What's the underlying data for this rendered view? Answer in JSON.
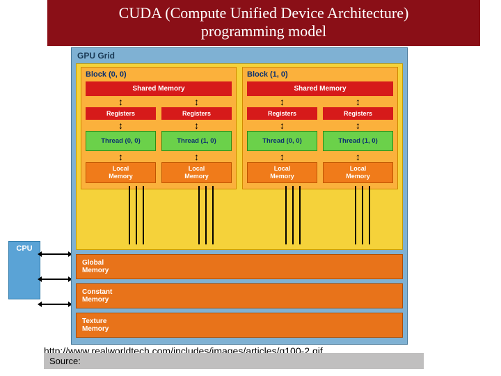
{
  "title": {
    "line1": "CUDA (Compute Unified Device Architecture)",
    "line2": "programming model"
  },
  "cpu_label": "CPU",
  "gpu": {
    "title": "GPU Grid",
    "blocks": [
      {
        "title": "Block (0, 0)",
        "shared": "Shared Memory",
        "regs": [
          "Registers",
          "Registers"
        ],
        "threads": [
          "Thread (0, 0)",
          "Thread (1, 0)"
        ],
        "locals": [
          "Local\nMemory",
          "Local\nMemory"
        ]
      },
      {
        "title": "Block (1, 0)",
        "shared": "Shared Memory",
        "regs": [
          "Registers",
          "Registers"
        ],
        "threads": [
          "Thread (0, 0)",
          "Thread (1, 0)"
        ],
        "locals": [
          "Local\nMemory",
          "Local\nMemory"
        ]
      }
    ],
    "global_mem": "Global\nMemory",
    "constant_mem": "Constant\nMemory",
    "texture_mem": "Texture\nMemory"
  },
  "source": {
    "label": "Source:",
    "url": "http://www.realworldtech.com/includes/images/articles/g100-2.gif"
  }
}
